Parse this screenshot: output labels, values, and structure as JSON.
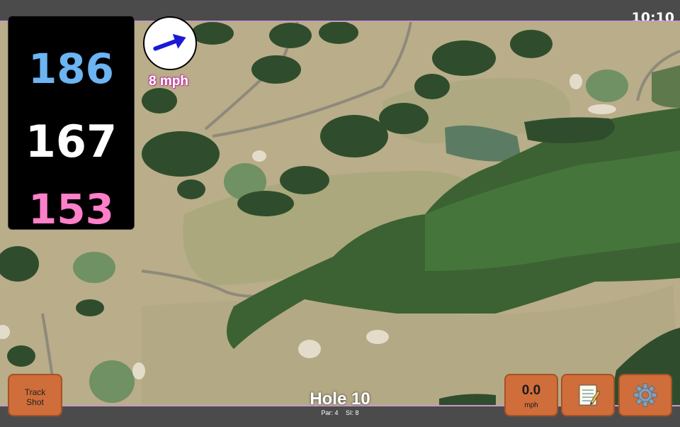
{
  "status": {
    "time": "10:10"
  },
  "distances": {
    "back": "186",
    "middle": "167",
    "front": "153"
  },
  "wind": {
    "label": "8 mph",
    "direction_icon": "wind-arrow-icon"
  },
  "hole": {
    "title": "Hole 10",
    "par": "Par: 4",
    "stroke_index": "SI: 8"
  },
  "buttons": {
    "track_shot": {
      "line1": "Track",
      "line2": "Shot"
    },
    "wind_speed": {
      "value": "0.0",
      "unit": "mph"
    },
    "notes_icon": "notepad-icon",
    "settings_icon": "gear-icon"
  },
  "colors": {
    "back_distance": "#6cb4f2",
    "middle_distance": "#ffffff",
    "front_distance": "#ff7fc9",
    "button": "#cf6d3b",
    "wind_arrow": "#1a1ad6"
  }
}
